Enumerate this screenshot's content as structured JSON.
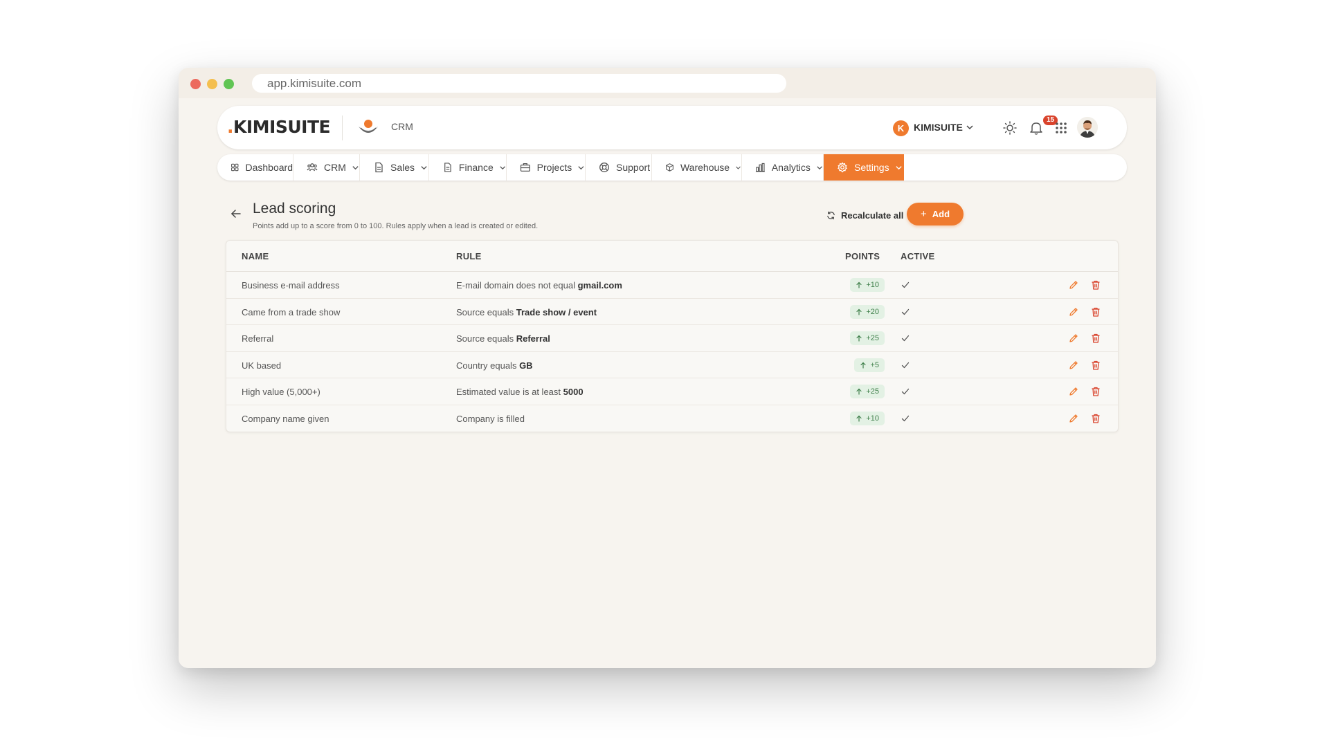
{
  "browser": {
    "url": "app.kimisuite.com"
  },
  "topbar": {
    "logo_dot": ".",
    "logo_text": "KIMISUITE",
    "app_label": "CRM",
    "org_initial": "K",
    "org_name": "KIMISUITE",
    "notification_count": "15"
  },
  "nav": {
    "items": [
      {
        "label": "Dashboard",
        "icon": "grid-icon"
      },
      {
        "label": "CRM",
        "icon": "users-icon"
      },
      {
        "label": "Sales",
        "icon": "document-icon"
      },
      {
        "label": "Finance",
        "icon": "document-icon"
      },
      {
        "label": "Projects",
        "icon": "briefcase-icon"
      },
      {
        "label": "Support",
        "icon": "lifebuoy-icon"
      },
      {
        "label": "Warehouse",
        "icon": "box-icon"
      },
      {
        "label": "Analytics",
        "icon": "bar-chart-icon"
      },
      {
        "label": "Settings",
        "icon": "gear-icon",
        "active": true
      }
    ]
  },
  "page": {
    "title": "Lead scoring",
    "subtitle": "Points add up to a score from 0 to 100. Rules apply when a lead is created or edited.",
    "recalculate_label": "Recalculate all",
    "add_label": "Add"
  },
  "table": {
    "columns": {
      "name": "NAME",
      "rule": "RULE",
      "points": "POINTS",
      "active": "ACTIVE"
    },
    "rows": [
      {
        "name": "Business e-mail address",
        "rule_prefix": "E-mail domain does not equal ",
        "rule_value": "gmail.com",
        "points": "+10",
        "active": true
      },
      {
        "name": "Came from a trade show",
        "rule_prefix": "Source equals ",
        "rule_value": "Trade show / event",
        "points": "+20",
        "active": true
      },
      {
        "name": "Referral",
        "rule_prefix": "Source equals ",
        "rule_value": "Referral",
        "points": "+25",
        "active": true
      },
      {
        "name": "UK based",
        "rule_prefix": "Country equals ",
        "rule_value": "GB",
        "points": "+5",
        "active": true
      },
      {
        "name": "High value (5,000+)",
        "rule_prefix": "Estimated value is at least ",
        "rule_value": "5000",
        "points": "+25",
        "active": true
      },
      {
        "name": "Company name given",
        "rule_prefix": "Company is filled",
        "rule_value": "",
        "points": "+10",
        "active": true
      }
    ]
  },
  "colors": {
    "accent": "#ef7a2e",
    "points_bg": "#e3f1e4",
    "points_fg": "#3f7f4a",
    "badge": "#d9432c"
  }
}
